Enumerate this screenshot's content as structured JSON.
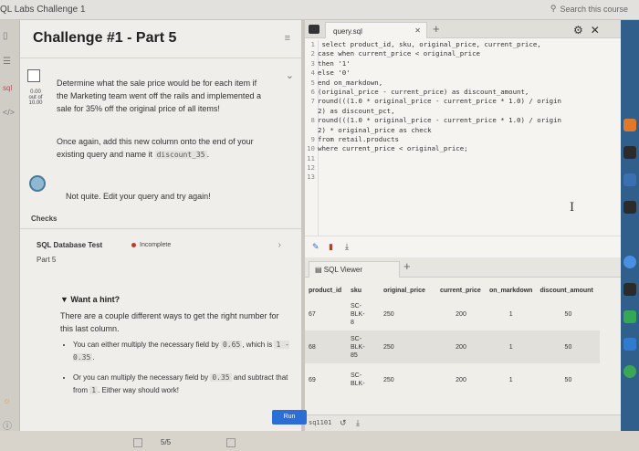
{
  "app": {
    "title": "QL Labs Challenge 1",
    "search": "Search this course"
  },
  "challenge": {
    "title": "Challenge #1 - Part 5",
    "score": {
      "value": "0.00",
      "out_of": "out of",
      "total": "10.00"
    },
    "task_text": "Determine what the sale price would be for each item if the Marketing team went off the rails and implemented a sale for 35% off the original price of all items!",
    "task_text2": "Once again, add this new column onto the end of your existing query and name it",
    "task_column": "discount_35",
    "feedback": "Not quite. Edit your query and try again!",
    "checks_label": "Checks",
    "test": {
      "name": "SQL Database Test",
      "status": "Incomplete",
      "part": "Part 5"
    },
    "hint": {
      "heading": "Want a hint?",
      "text": "There are a couple different ways to get the right number for this last column.",
      "bullet1_pre": "You can either multiply the necessary field by",
      "bullet1_code": "0.65",
      "bullet1_mid": "which is",
      "bullet1_code2": "1 - 0.35",
      "bullet2_pre": "Or you can multiply the necessary field by",
      "bullet2_code": "0.35",
      "bullet2_mid": "and subtract that from",
      "bullet2_code2": "1",
      "bullet2_post": ". Either way should work!"
    },
    "pager": "5/5"
  },
  "editor": {
    "tab": "query.sql",
    "lines": [
      {
        "n": "1",
        "t": " select product_id, sku, original_price, current_price,"
      },
      {
        "n": "2",
        "t": "case when current_price < original_price"
      },
      {
        "n": "3",
        "t": "then '1'"
      },
      {
        "n": "4",
        "t": "else '0'"
      },
      {
        "n": "5",
        "t": "end on_markdown,"
      },
      {
        "n": "6",
        "t": "(original_price - current_price) as discount_amount,"
      },
      {
        "n": "7",
        "t": "round(((1.0 * original_price - current_price * 1.0) / origin"
      },
      {
        "n": "",
        "t": "2) as discount_pct,"
      },
      {
        "n": "8",
        "t": "round(((1.0 * original_price - current_price * 1.0) / origin"
      },
      {
        "n": "",
        "t": "2) * original_price as check"
      },
      {
        "n": "9",
        "t": "from retail.products"
      },
      {
        "n": "10",
        "t": "where current_price < original_price;"
      },
      {
        "n": "11",
        "t": ""
      },
      {
        "n": "12",
        "t": ""
      },
      {
        "n": "13",
        "t": ""
      }
    ]
  },
  "results": {
    "tab": "SQL Viewer",
    "columns": [
      "product_id",
      "sku",
      "original_price",
      "current_price",
      "on_markdown",
      "discount_amount"
    ],
    "rows": [
      {
        "product_id": "67",
        "sku": "SC-\nBLK-\n8",
        "original_price": "250",
        "current_price": "200",
        "on_markdown": "1",
        "discount_amount": "50"
      },
      {
        "product_id": "68",
        "sku": "SC-\nBLK-\n85",
        "original_price": "250",
        "current_price": "200",
        "on_markdown": "1",
        "discount_amount": "50"
      },
      {
        "product_id": "69",
        "sku": "SC-\nBLK-",
        "original_price": "250",
        "current_price": "200",
        "on_markdown": "1",
        "discount_amount": "50"
      }
    ],
    "query_name": "sq1101",
    "run_label": "Run"
  }
}
